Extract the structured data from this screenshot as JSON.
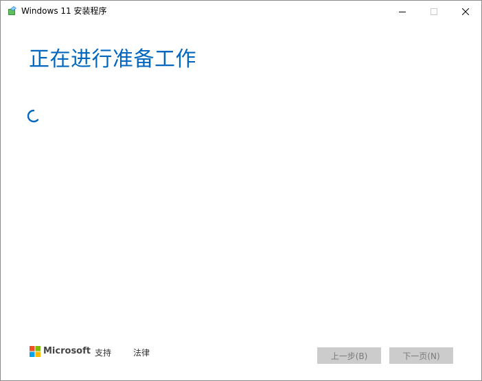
{
  "window": {
    "title": "Windows 11 安装程序"
  },
  "main": {
    "heading": "正在进行准备工作"
  },
  "footer": {
    "brand": "Microsoft",
    "support_link": "支持",
    "legal_link": "法律",
    "back_button": "上一步(B)",
    "next_button": "下一页(N)"
  },
  "colors": {
    "accent": "#0067c0",
    "disabled_button_bg": "#cccccc",
    "disabled_button_text": "#7a7a7a"
  },
  "icons": {
    "app": "setup-app-icon",
    "spinner": "loading-spinner-icon",
    "logo": "microsoft-logo-icon"
  }
}
